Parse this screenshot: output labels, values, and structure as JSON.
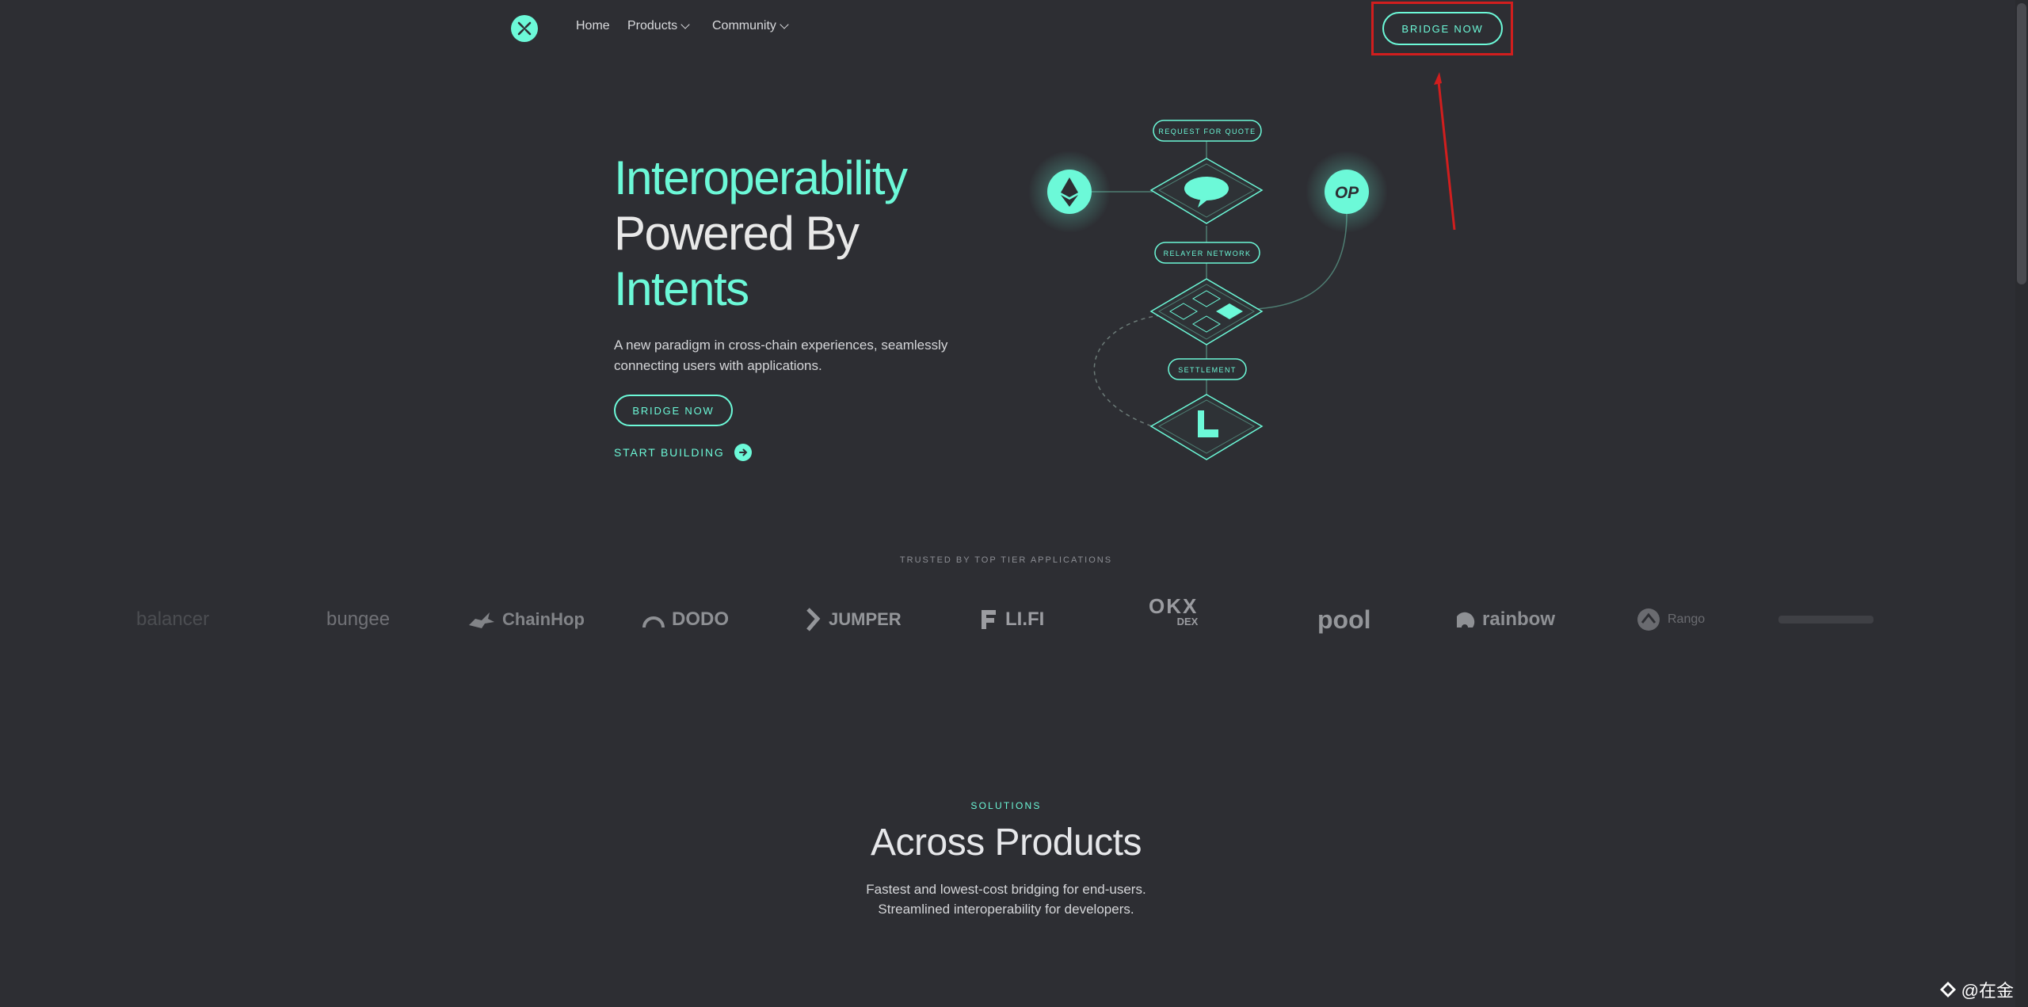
{
  "nav": {
    "links": [
      {
        "label": "Home"
      },
      {
        "label": "Products"
      },
      {
        "label": "Community"
      }
    ],
    "cta_label": "BRIDGE NOW"
  },
  "hero": {
    "title_line1": "Interoperability",
    "title_line2": "Powered By",
    "title_line3": "Intents",
    "subtitle_line1": "A new paradigm in cross-chain experiences, seamlessly",
    "subtitle_line2": "connecting users with applications.",
    "bridge_label": "BRIDGE NOW",
    "start_label": "START BUILDING"
  },
  "diagram": {
    "pill_request": "REQUEST FOR QUOTE",
    "pill_relayer": "RELAYER NETWORK",
    "pill_settlement": "SETTLEMENT",
    "op_label": "OP"
  },
  "trusted": {
    "label": "TRUSTED BY TOP TIER APPLICATIONS",
    "logos": [
      "balancer",
      "bungee",
      "ChainHop",
      "DODO",
      "JUMPER",
      "LI.FI",
      "OKX",
      "DEX",
      "pool",
      "rainbow",
      "Rango"
    ]
  },
  "solutions": {
    "label": "SOLUTIONS",
    "title": "Across Products",
    "sub_line1": "Fastest and lowest-cost bridging for end-users.",
    "sub_line2": "Streamlined interoperability for developers."
  },
  "watermark": "@在金",
  "colors": {
    "accent": "#6cf9d8",
    "background": "#2d2e33",
    "highlight": "#d11e1e"
  }
}
